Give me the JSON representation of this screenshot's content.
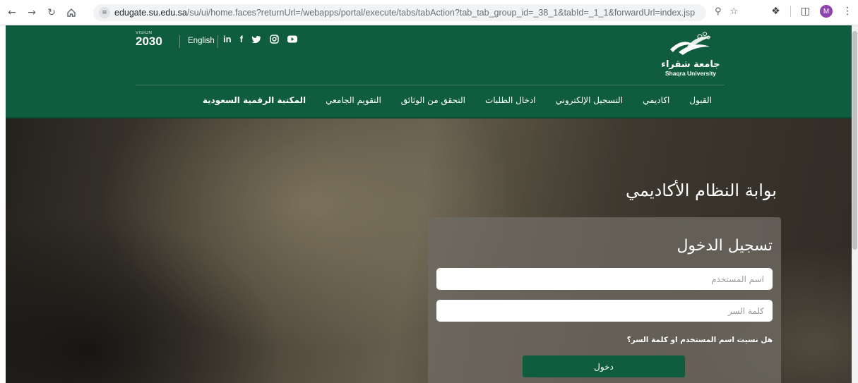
{
  "browser": {
    "url_host": "edugate.su.edu.sa",
    "url_path": "/su/ui/home.faces?returnUrl=/webapps/portal/execute/tabs/tabAction?tab_tab_group_id=_38_1&tabId=_1_1&forwardUrl=index.jsp",
    "profile_initial": "M",
    "icons": [
      "back-icon",
      "forward-icon",
      "reload-icon",
      "home-icon",
      "site-info-icon",
      "password-key-icon",
      "bookmark-star-icon",
      "extensions-icon",
      "side-panel-icon",
      "profile-icon",
      "menu-icon"
    ]
  },
  "header": {
    "vision_small": "VISION",
    "vision_year": "2030",
    "language_link": "English",
    "socials": [
      "in",
      "f",
      "t",
      "ig",
      "yt"
    ],
    "logo_arabic": "جامعة شقراء",
    "logo_english": "Shaqra University",
    "nav": [
      {
        "label": "القبول",
        "bold": false
      },
      {
        "label": "اكاديمي",
        "bold": false
      },
      {
        "label": "التسجيل الإلكتروني",
        "bold": false
      },
      {
        "label": "ادخال الطلبات",
        "bold": false
      },
      {
        "label": "التحقق من الوثائق",
        "bold": false
      },
      {
        "label": "التقويم الجامعي",
        "bold": false
      },
      {
        "label": "المكتبة الرقمية السعودية",
        "bold": true
      }
    ]
  },
  "hero": {
    "title": "بوابة النظام الأكاديمي"
  },
  "login": {
    "title": "تسجيل الدخول",
    "username_placeholder": "اسم المستخدم",
    "password_placeholder": "كلمة السر",
    "forgot_link": "هل نسيت اسم المستخدم او كلمة السر؟",
    "submit_label": "دخول"
  },
  "colors": {
    "brand_green": "#0f5c3f"
  }
}
